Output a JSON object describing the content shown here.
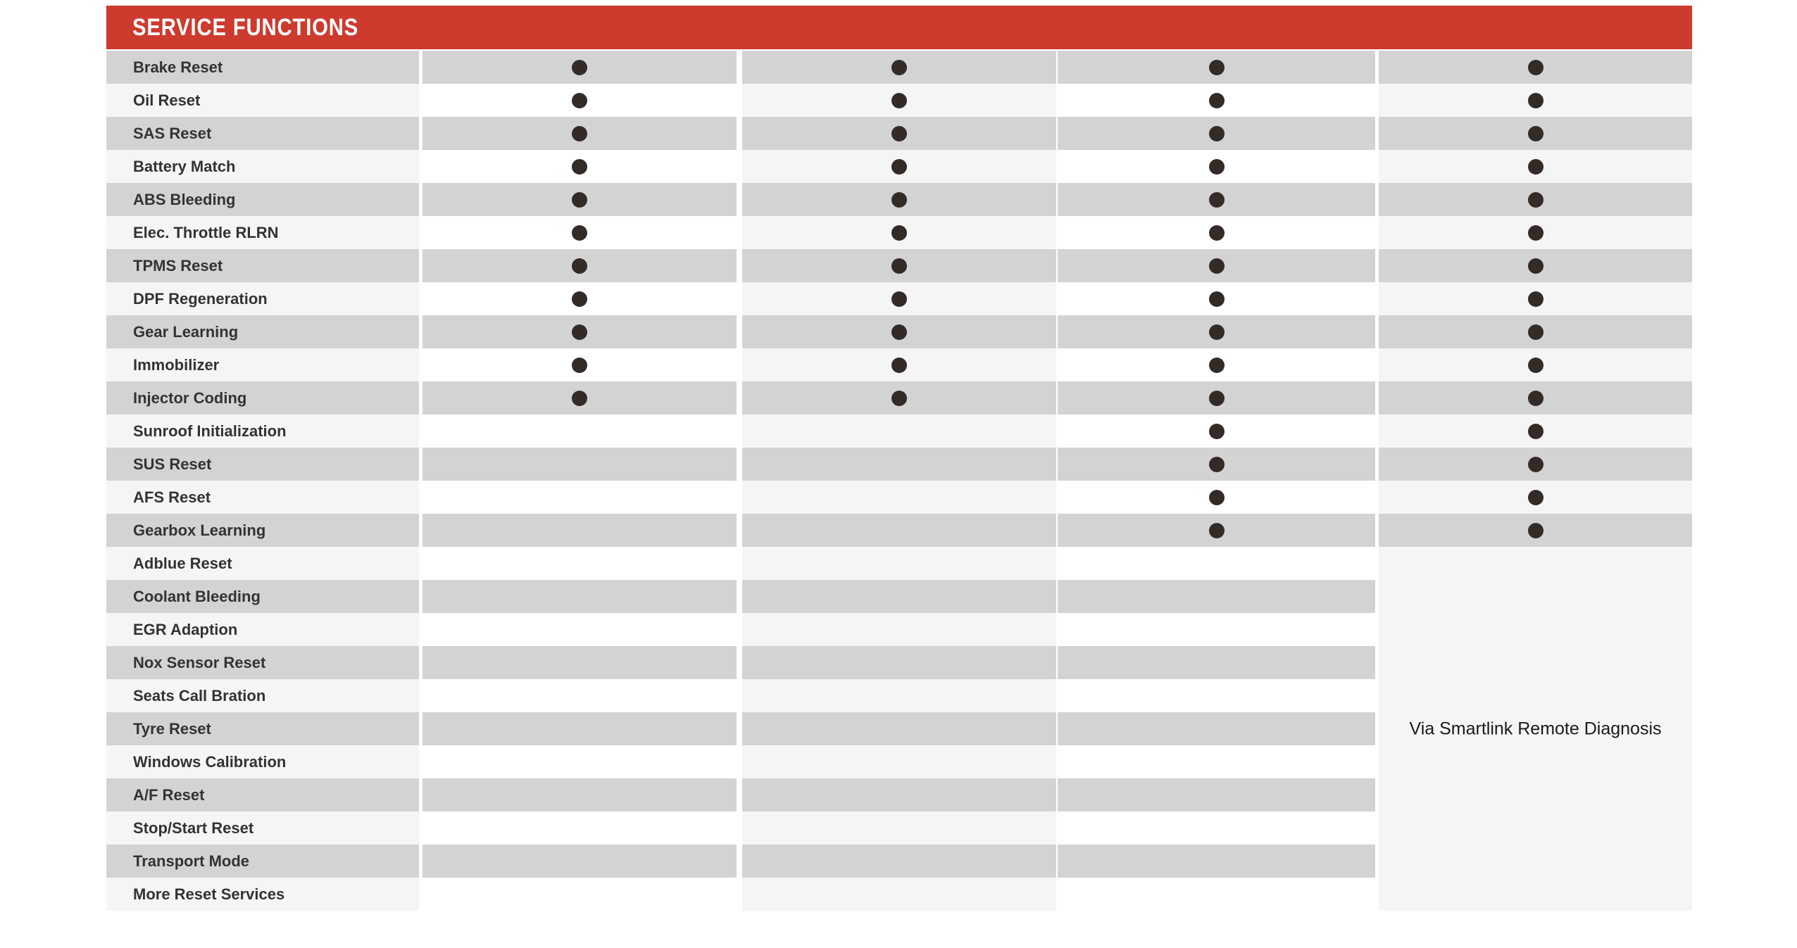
{
  "header": {
    "title": "SERVICE FUNCTIONS",
    "band_color": "#cd3a2e",
    "title_color": "#ffffff"
  },
  "theme": {
    "stripe_dark": "#d3d3d3",
    "stripe_light": "#f5f5f5",
    "stripe_white": "#ffffff",
    "dot_color": "#332b28",
    "label_text_color": "#333333",
    "page_background": "#ffffff"
  },
  "table": {
    "columns": [
      {
        "id": "col-1",
        "label": ""
      },
      {
        "id": "col-2",
        "label": ""
      },
      {
        "id": "col-3",
        "label": ""
      },
      {
        "id": "col-4",
        "label": ""
      }
    ],
    "merged_note": {
      "column_index": 3,
      "start_row_index": 15,
      "end_row_index": 25,
      "text": "Via Smartlink Remote Diagnosis"
    },
    "rows": [
      {
        "label": "Brake Reset",
        "marks": [
          true,
          true,
          true,
          true
        ]
      },
      {
        "label": "Oil Reset",
        "marks": [
          true,
          true,
          true,
          true
        ]
      },
      {
        "label": "SAS Reset",
        "marks": [
          true,
          true,
          true,
          true
        ]
      },
      {
        "label": "Battery Match",
        "marks": [
          true,
          true,
          true,
          true
        ]
      },
      {
        "label": "ABS Bleeding",
        "marks": [
          true,
          true,
          true,
          true
        ]
      },
      {
        "label": "Elec. Throttle RLRN",
        "marks": [
          true,
          true,
          true,
          true
        ]
      },
      {
        "label": "TPMS Reset",
        "marks": [
          true,
          true,
          true,
          true
        ]
      },
      {
        "label": "DPF Regeneration",
        "marks": [
          true,
          true,
          true,
          true
        ]
      },
      {
        "label": "Gear Learning",
        "marks": [
          true,
          true,
          true,
          true
        ]
      },
      {
        "label": "Immobilizer",
        "marks": [
          true,
          true,
          true,
          true
        ]
      },
      {
        "label": "Injector Coding",
        "marks": [
          true,
          true,
          true,
          true
        ]
      },
      {
        "label": "Sunroof Initialization",
        "marks": [
          false,
          false,
          true,
          true
        ]
      },
      {
        "label": "SUS Reset",
        "marks": [
          false,
          false,
          true,
          true
        ]
      },
      {
        "label": "AFS Reset",
        "marks": [
          false,
          false,
          true,
          true
        ]
      },
      {
        "label": "Gearbox Learning",
        "marks": [
          false,
          false,
          true,
          true
        ]
      },
      {
        "label": "Adblue Reset",
        "marks": [
          false,
          false,
          false,
          false
        ]
      },
      {
        "label": "Coolant Bleeding",
        "marks": [
          false,
          false,
          false,
          false
        ]
      },
      {
        "label": "EGR Adaption",
        "marks": [
          false,
          false,
          false,
          false
        ]
      },
      {
        "label": "Nox Sensor Reset",
        "marks": [
          false,
          false,
          false,
          false
        ]
      },
      {
        "label": "Seats Call Bration",
        "marks": [
          false,
          false,
          false,
          false
        ]
      },
      {
        "label": "Tyre Reset",
        "marks": [
          false,
          false,
          false,
          false
        ]
      },
      {
        "label": "Windows Calibration",
        "marks": [
          false,
          false,
          false,
          false
        ]
      },
      {
        "label": "A/F Reset",
        "marks": [
          false,
          false,
          false,
          false
        ]
      },
      {
        "label": "Stop/Start Reset",
        "marks": [
          false,
          false,
          false,
          false
        ]
      },
      {
        "label": "Transport Mode",
        "marks": [
          false,
          false,
          false,
          false
        ]
      },
      {
        "label": "More Reset Services",
        "marks": [
          false,
          false,
          false,
          false
        ]
      }
    ]
  }
}
